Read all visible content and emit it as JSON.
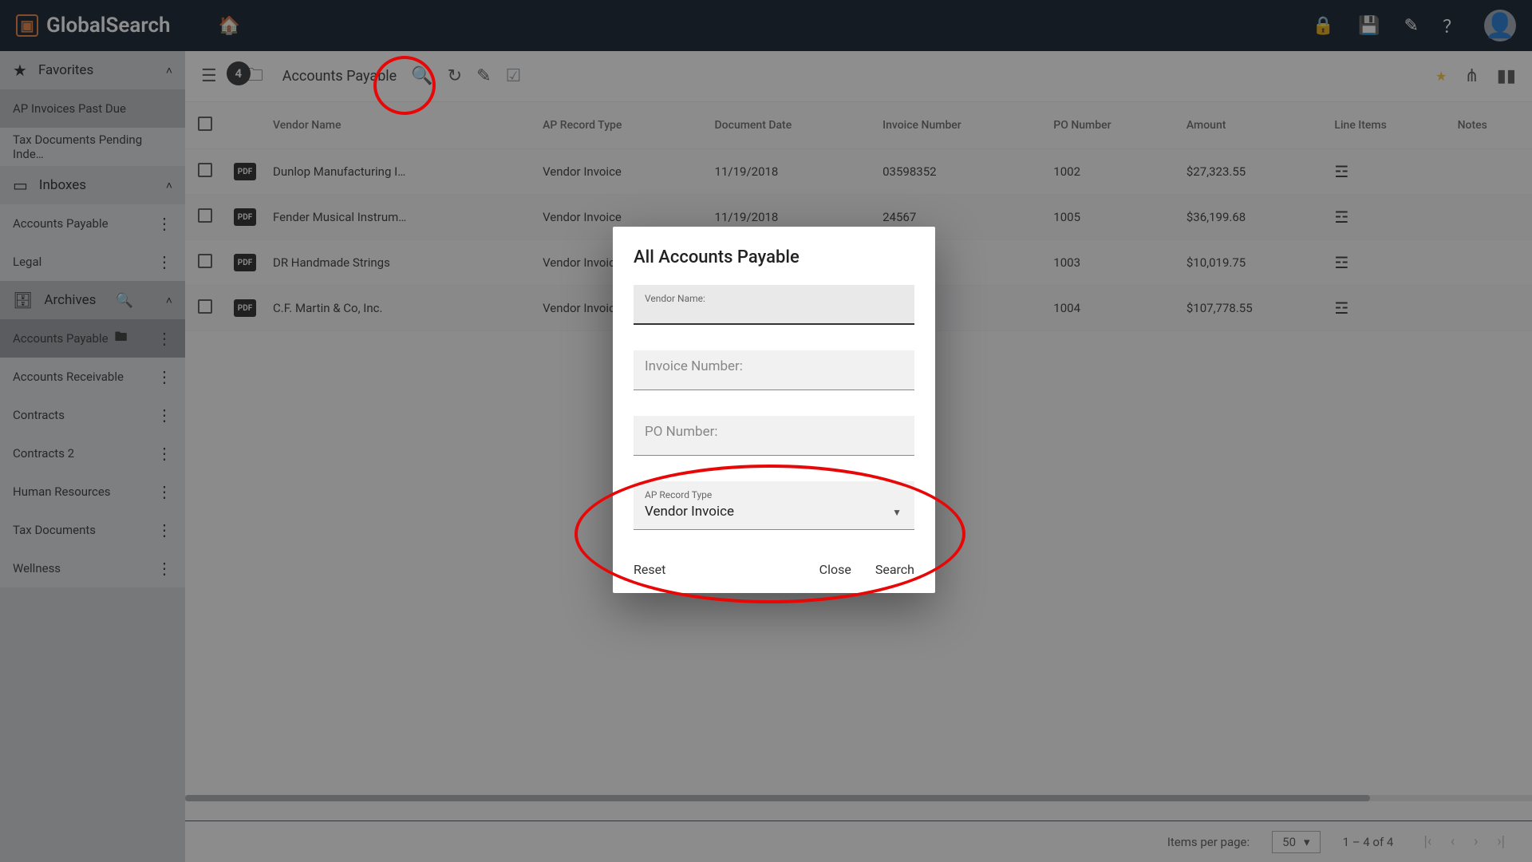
{
  "app": {
    "name": "GlobalSearch"
  },
  "header_icons": [
    "lock",
    "save",
    "note",
    "help",
    "account"
  ],
  "sidebar": {
    "favorites_label": "Favorites",
    "fav_items": [
      {
        "label": "AP Invoices Past Due"
      },
      {
        "label": "Tax Documents Pending Inde…"
      }
    ],
    "inboxes_label": "Inboxes",
    "inbox_items": [
      {
        "label": "Accounts Payable"
      },
      {
        "label": "Legal"
      }
    ],
    "archives_label": "Archives",
    "archive_items": [
      {
        "label": "Accounts Payable",
        "selected": true
      },
      {
        "label": "Accounts Receivable"
      },
      {
        "label": "Contracts"
      },
      {
        "label": "Contracts 2"
      },
      {
        "label": "Human Resources"
      },
      {
        "label": "Tax Documents"
      },
      {
        "label": "Wellness"
      }
    ]
  },
  "toolbar": {
    "count_badge": "4",
    "title": "Accounts Payable"
  },
  "columns": [
    "Vendor Name",
    "AP Record Type",
    "Document Date",
    "Invoice Number",
    "PO Number",
    "Amount",
    "Line Items",
    "Notes"
  ],
  "rows": [
    {
      "vendor": "Dunlop Manufacturing I…",
      "type": "Vendor Invoice",
      "date": "11/19/2018",
      "inv": "03598352",
      "po": "1002",
      "amount": "$27,323.55"
    },
    {
      "vendor": "Fender Musical Instrum…",
      "type": "Vendor Invoice",
      "date": "11/19/2018",
      "inv": "24567",
      "po": "1005",
      "amount": "$36,199.68"
    },
    {
      "vendor": "DR Handmade Strings",
      "type": "Vendor Invoice",
      "date": "",
      "inv": "",
      "po": "1003",
      "amount": "$10,019.75"
    },
    {
      "vendor": "C.F. Martin & Co, Inc.",
      "type": "Vendor Invoice",
      "date": "",
      "inv": "",
      "po": "1004",
      "amount": "$107,778.55"
    }
  ],
  "dialog": {
    "title": "All Accounts Payable",
    "vendor_label": "Vendor Name:",
    "invoice_label": "Invoice Number:",
    "po_label": "PO Number:",
    "rectype_label": "AP Record Type",
    "rectype_value": "Vendor Invoice",
    "reset": "Reset",
    "close": "Close",
    "search": "Search"
  },
  "paginator": {
    "label": "Items per page:",
    "size": "50",
    "range": "1 – 4 of 4"
  }
}
